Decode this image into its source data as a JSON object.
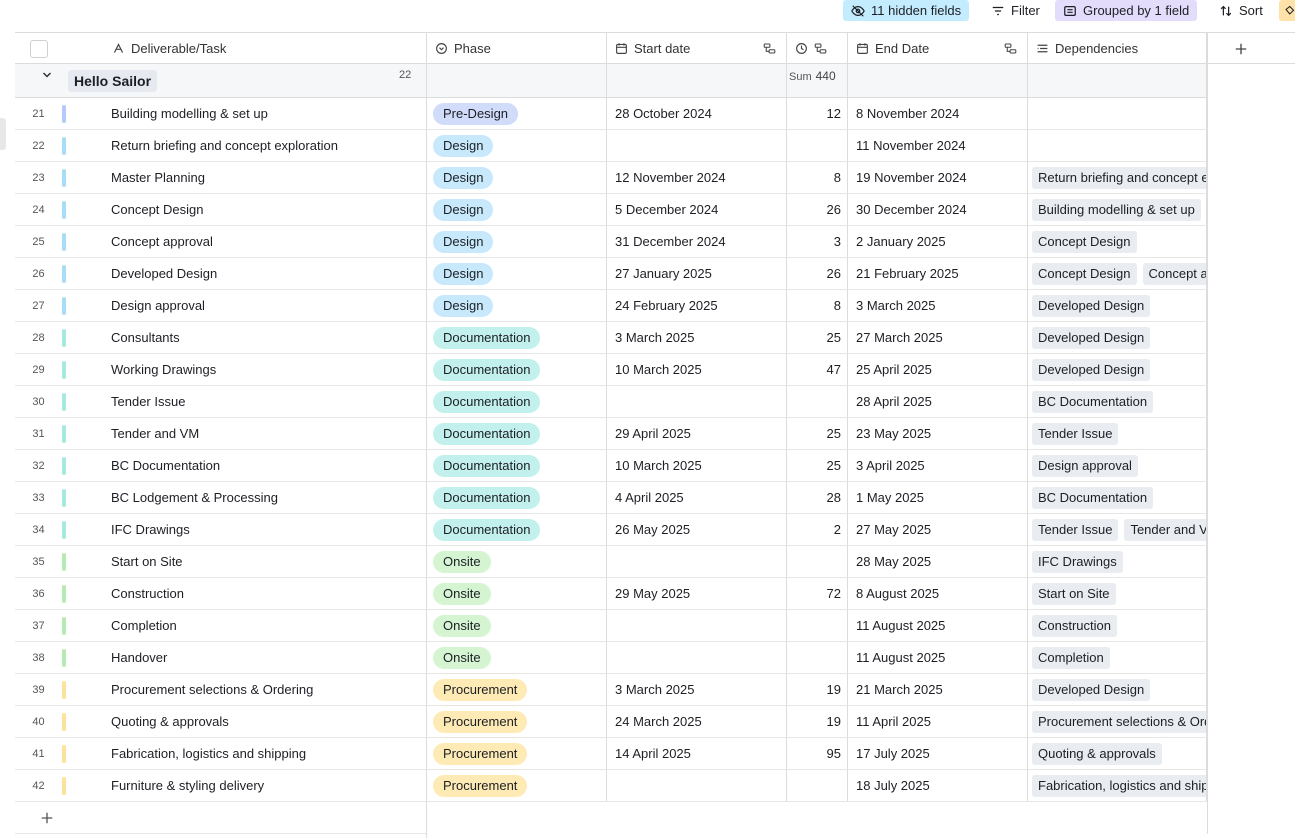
{
  "toolbar": {
    "hidden_fields": "11 hidden fields",
    "filter": "Filter",
    "grouped": "Grouped by 1 field",
    "sort": "Sort"
  },
  "columns": {
    "task": "Deliverable/Task",
    "phase": "Phase",
    "start": "Start date",
    "end": "End Date",
    "dependencies": "Dependencies"
  },
  "group": {
    "name": "Hello Sailor",
    "count": "22",
    "sum_label": "Sum",
    "sum_value": "440"
  },
  "phase_colors": {
    "Pre-Design": "#d1dbfa",
    "Design": "#c8e9fb",
    "Documentation": "#c2f0ec",
    "Onsite": "#d5f4d2",
    "Procurement": "#feeab4"
  },
  "phase_bar_colors": {
    "Pre-Design": "#b7c8fa",
    "Design": "#a9dcfa",
    "Documentation": "#a5e9e2",
    "Onsite": "#b8ebb4",
    "Procurement": "#fde29a"
  },
  "rows": [
    {
      "num": "21",
      "name": "Building modelling & set up",
      "phase": "Pre-Design",
      "start": "28 October 2024",
      "dur": "12",
      "end": "8 November 2024",
      "deps": []
    },
    {
      "num": "22",
      "name": "Return briefing and concept exploration",
      "phase": "Design",
      "start": "",
      "dur": "",
      "end": "11 November 2024",
      "deps": []
    },
    {
      "num": "23",
      "name": "Master Planning",
      "phase": "Design",
      "start": "12 November 2024",
      "dur": "8",
      "end": "19 November 2024",
      "deps": [
        "Return briefing and concept exploration"
      ]
    },
    {
      "num": "24",
      "name": "Concept Design",
      "phase": "Design",
      "start": "5 December 2024",
      "dur": "26",
      "end": "30 December 2024",
      "deps": [
        "Building modelling & set up"
      ]
    },
    {
      "num": "25",
      "name": "Concept approval",
      "phase": "Design",
      "start": "31 December 2024",
      "dur": "3",
      "end": "2 January 2025",
      "deps": [
        "Concept Design"
      ]
    },
    {
      "num": "26",
      "name": "Developed Design",
      "phase": "Design",
      "start": "27 January 2025",
      "dur": "26",
      "end": "21 February 2025",
      "deps": [
        "Concept Design",
        "Concept approval"
      ]
    },
    {
      "num": "27",
      "name": "Design approval",
      "phase": "Design",
      "start": "24 February 2025",
      "dur": "8",
      "end": "3 March 2025",
      "deps": [
        "Developed Design"
      ]
    },
    {
      "num": "28",
      "name": "Consultants",
      "phase": "Documentation",
      "start": "3 March 2025",
      "dur": "25",
      "end": "27 March 2025",
      "deps": [
        "Developed Design"
      ]
    },
    {
      "num": "29",
      "name": "Working Drawings",
      "phase": "Documentation",
      "start": "10 March 2025",
      "dur": "47",
      "end": "25 April 2025",
      "deps": [
        "Developed Design"
      ]
    },
    {
      "num": "30",
      "name": "Tender Issue",
      "phase": "Documentation",
      "start": "",
      "dur": "",
      "end": "28 April 2025",
      "deps": [
        "BC Documentation"
      ]
    },
    {
      "num": "31",
      "name": "Tender and VM",
      "phase": "Documentation",
      "start": "29 April 2025",
      "dur": "25",
      "end": "23 May 2025",
      "deps": [
        "Tender Issue"
      ]
    },
    {
      "num": "32",
      "name": "BC Documentation",
      "phase": "Documentation",
      "start": "10 March 2025",
      "dur": "25",
      "end": "3 April 2025",
      "deps": [
        "Design approval"
      ]
    },
    {
      "num": "33",
      "name": "BC Lodgement & Processing",
      "phase": "Documentation",
      "start": "4 April 2025",
      "dur": "28",
      "end": "1 May 2025",
      "deps": [
        "BC Documentation"
      ]
    },
    {
      "num": "34",
      "name": "IFC Drawings",
      "phase": "Documentation",
      "start": "26 May 2025",
      "dur": "2",
      "end": "27 May 2025",
      "deps": [
        "Tender Issue",
        "Tender and VM"
      ]
    },
    {
      "num": "35",
      "name": "Start on Site",
      "phase": "Onsite",
      "start": "",
      "dur": "",
      "end": "28 May 2025",
      "deps": [
        "IFC Drawings"
      ]
    },
    {
      "num": "36",
      "name": "Construction",
      "phase": "Onsite",
      "start": "29 May 2025",
      "dur": "72",
      "end": "8 August 2025",
      "deps": [
        "Start on Site"
      ]
    },
    {
      "num": "37",
      "name": "Completion",
      "phase": "Onsite",
      "start": "",
      "dur": "",
      "end": "11 August 2025",
      "deps": [
        "Construction"
      ]
    },
    {
      "num": "38",
      "name": "Handover",
      "phase": "Onsite",
      "start": "",
      "dur": "",
      "end": "11 August 2025",
      "deps": [
        "Completion"
      ]
    },
    {
      "num": "39",
      "name": "Procurement selections & Ordering",
      "phase": "Procurement",
      "start": "3 March 2025",
      "dur": "19",
      "end": "21 March 2025",
      "deps": [
        "Developed Design"
      ]
    },
    {
      "num": "40",
      "name": "Quoting & approvals",
      "phase": "Procurement",
      "start": "24 March 2025",
      "dur": "19",
      "end": "11 April 2025",
      "deps": [
        "Procurement selections & Ordering"
      ]
    },
    {
      "num": "41",
      "name": "Fabrication, logistics and shipping",
      "phase": "Procurement",
      "start": "14 April 2025",
      "dur": "95",
      "end": "17 July 2025",
      "deps": [
        "Quoting & approvals"
      ]
    },
    {
      "num": "42",
      "name": "Furniture & styling delivery",
      "phase": "Procurement",
      "start": "",
      "dur": "",
      "end": "18 July 2025",
      "deps": [
        "Fabrication, logistics and shipping"
      ]
    }
  ]
}
